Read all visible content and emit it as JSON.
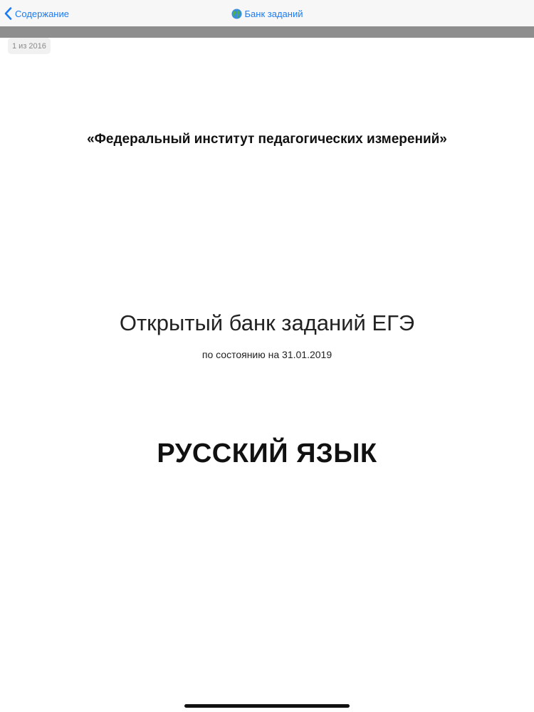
{
  "nav": {
    "back_label": "Содержание",
    "title": "Банк заданий",
    "accent_color": "#1a7cf5",
    "back_icon": "chevron-left-icon",
    "title_icon": "globe-icon"
  },
  "viewer": {
    "page_indicator": "1 из 2016"
  },
  "document": {
    "institute": "«Федеральный институт педагогических измерений»",
    "title": "Открытый банк заданий ЕГЭ",
    "status_date": "по состоянию на 31.01.2019",
    "subject": "РУССКИЙ ЯЗЫК"
  }
}
